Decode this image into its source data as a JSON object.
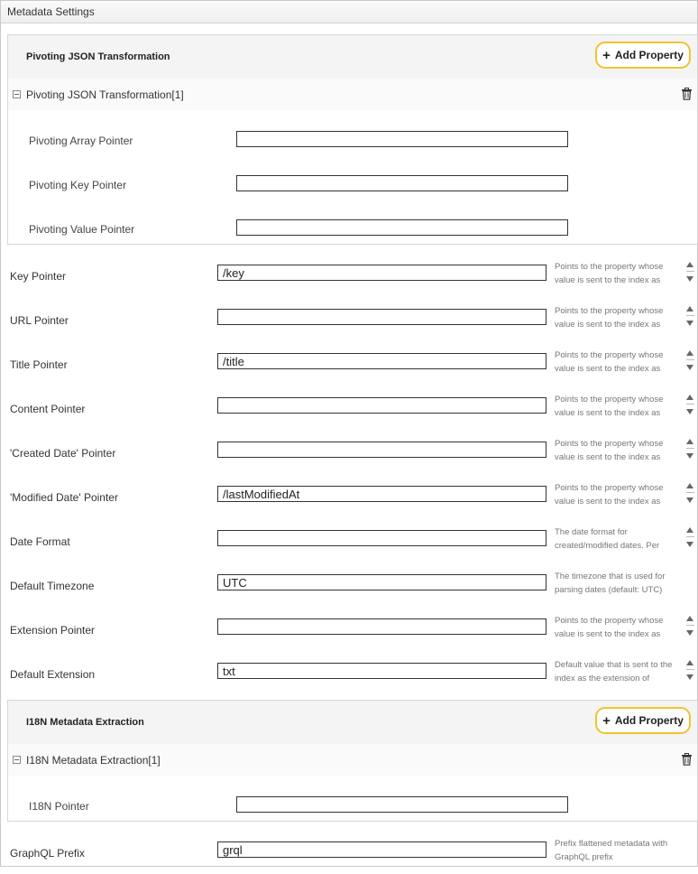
{
  "window": {
    "title": "Metadata Settings"
  },
  "pivot_group": {
    "title": "Pivoting JSON Transformation",
    "add_label": "Add Property",
    "item_title": "Pivoting JSON Transformation[1]",
    "fields": [
      {
        "label": "Pivoting Array Pointer",
        "value": ""
      },
      {
        "label": "Pivoting Key Pointer",
        "value": ""
      },
      {
        "label": "Pivoting Value Pointer",
        "value": ""
      }
    ]
  },
  "fields": [
    {
      "label": "Key Pointer",
      "value": "/key",
      "help": "Points to the property whose value is sent to the index as",
      "scroll": true
    },
    {
      "label": "URL Pointer",
      "value": "",
      "help": "Points to the property whose value is sent to the index as",
      "scroll": true
    },
    {
      "label": "Title Pointer",
      "value": "/title",
      "help": "Points to the property whose value is sent to the index as",
      "scroll": true
    },
    {
      "label": "Content Pointer",
      "value": "",
      "help": "Points to the property whose value is sent to the index as",
      "scroll": true
    },
    {
      "label": "'Created Date' Pointer",
      "value": "",
      "help": "Points to the property whose value is sent to the index as",
      "scroll": true
    },
    {
      "label": "'Modified Date' Pointer",
      "value": "/lastModifiedAt",
      "help": "Points to the property whose value is sent to the index as",
      "scroll": true
    },
    {
      "label": "Date Format",
      "value": "",
      "help": "The date format for created/modified dates. Per",
      "scroll": true
    },
    {
      "label": "Default Timezone",
      "value": "UTC",
      "help": "The timezone that is used for parsing dates (default: UTC)",
      "scroll": false
    },
    {
      "label": "Extension Pointer",
      "value": "",
      "help": "Points to the property whose value is sent to the index as",
      "scroll": true
    },
    {
      "label": "Default Extension",
      "value": "txt",
      "help": "Default value that is sent to the index as the extension of",
      "scroll": true
    }
  ],
  "i18n_group": {
    "title": "I18N Metadata Extraction",
    "add_label": "Add Property",
    "item_title": "I18N Metadata Extraction[1]",
    "fields": [
      {
        "label": "I18N Pointer",
        "value": ""
      }
    ]
  },
  "graphql": {
    "label": "GraphQL Prefix",
    "value": "grql",
    "help": "Prefix flattened metadata with GraphQL prefix"
  },
  "icons": {
    "add": "plus-icon",
    "collapse": "collapse-icon",
    "delete": "trash-icon",
    "scroll": "scroll-arrows-icon"
  }
}
